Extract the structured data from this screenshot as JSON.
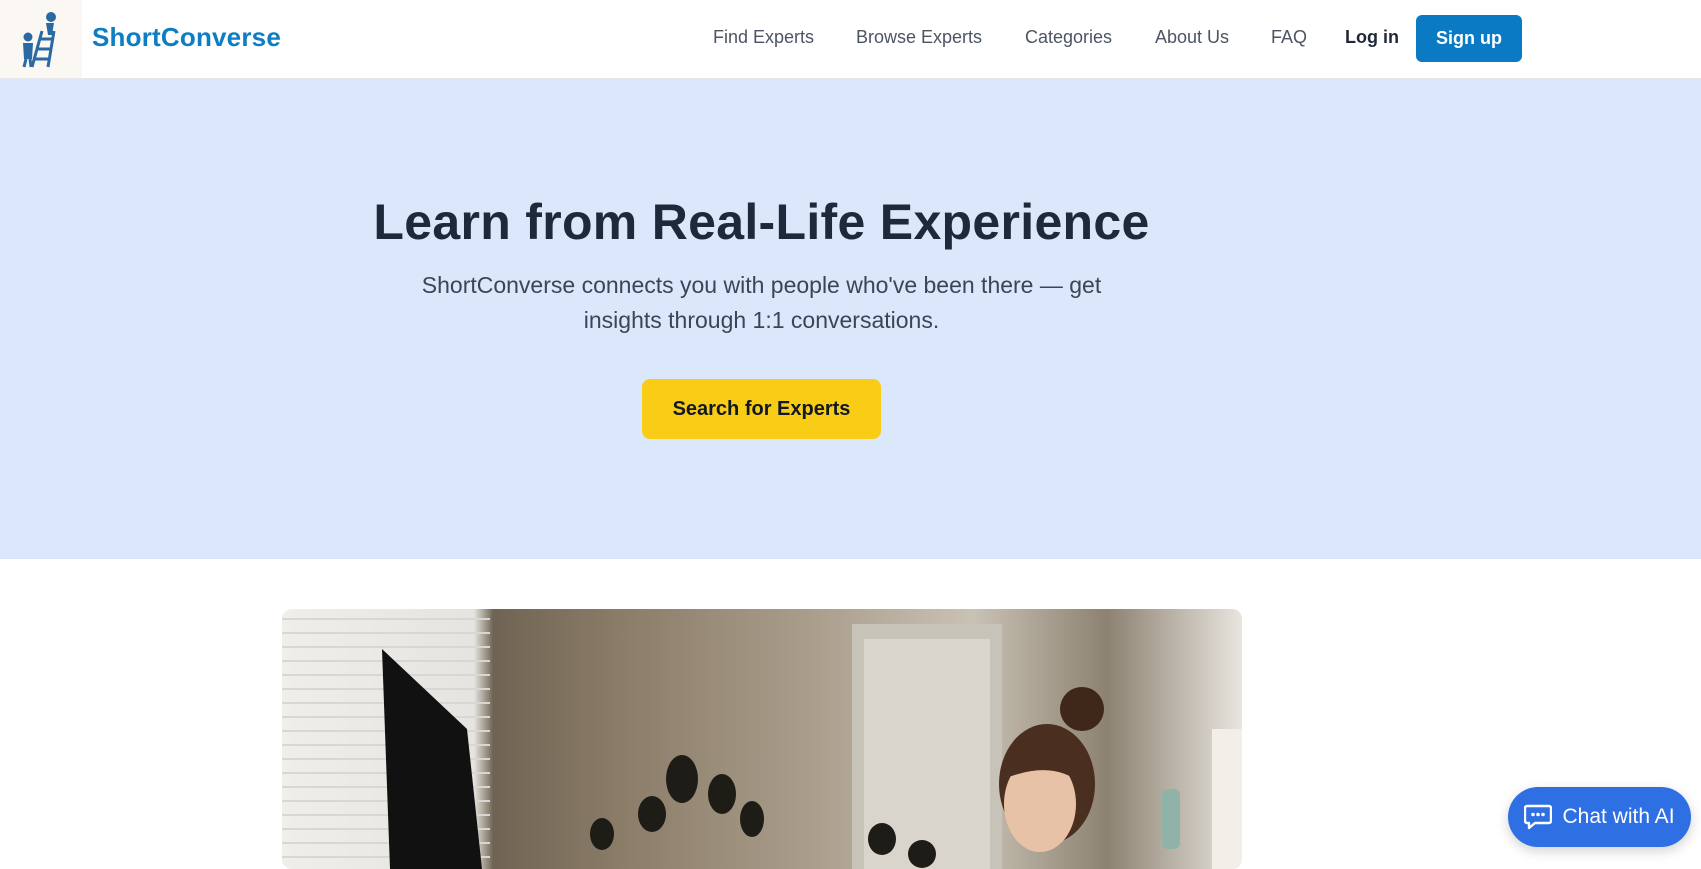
{
  "brand": {
    "name": "ShortConverse",
    "logo_icon": "ladder-climber-icon",
    "color": "#0e7ec2"
  },
  "nav": {
    "links": [
      "Find Experts",
      "Browse Experts",
      "Categories",
      "About Us",
      "FAQ"
    ],
    "login_label": "Log in",
    "signup_label": "Sign up"
  },
  "hero": {
    "title": "Learn from Real-Life Experience",
    "subtitle": "ShortConverse connects you with people who've been there — get insights through 1:1 conversations.",
    "cta_label": "Search for Experts",
    "background": "#dbe8fb",
    "cta_color": "#f9cc16"
  },
  "photo": {
    "subject": "smiling woman at desk with monitor and plants"
  },
  "chat": {
    "label": "Chat with AI",
    "icon": "chat-bubble-icon",
    "color": "#2f6fe4"
  }
}
